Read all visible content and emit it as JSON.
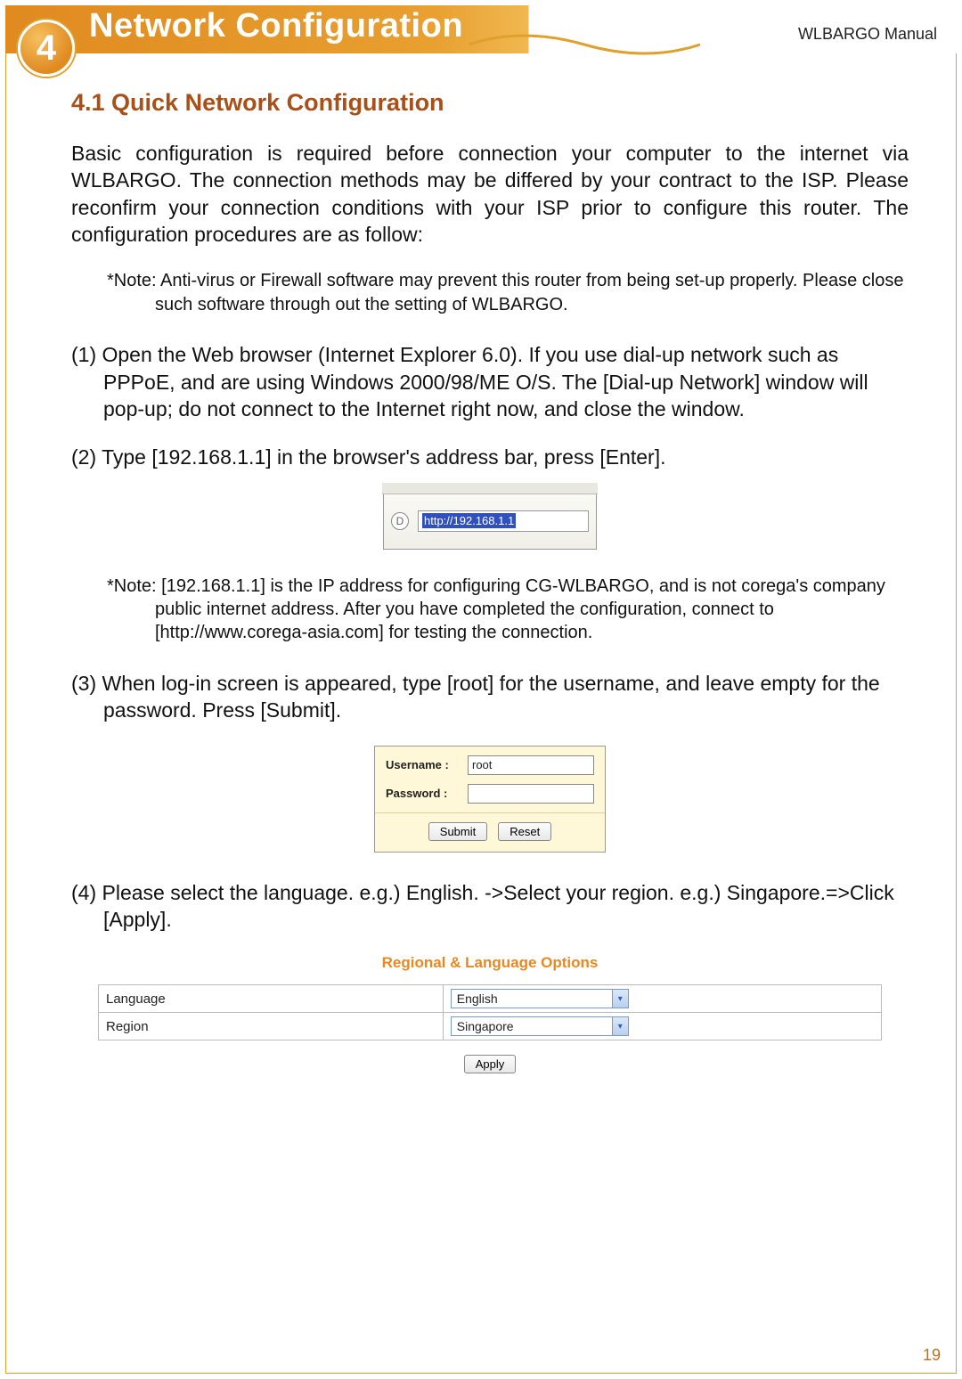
{
  "header": {
    "chapter_number": "4",
    "chapter_title": "Network Configuration",
    "manual_label": "WLBARGO Manual"
  },
  "section": {
    "title": "4.1 Quick Network Configuration",
    "intro": "Basic configuration is required before connection your computer to the internet via WLBARGO. The connection methods may be differed by your contract to the ISP. Please reconfirm your connection conditions with your ISP prior to configure this router. The configuration procedures are as follow:",
    "note1": "*Note: Anti-virus or Firewall software may prevent this router from being set-up properly. Please close such software through out the setting of WLBARGO.",
    "step1": "(1) Open the Web browser (Internet Explorer 6.0). If you use dial-up network such as PPPoE, and are using Windows 2000/98/ME O/S. The [Dial-up Network] window will pop-up; do not connect to the Internet right now, and close the window.",
    "step2": "(2) Type [192.168.1.1] in the browser's address bar, press [Enter].",
    "url_text": "http://192.168.1.1",
    "note2": "*Note: [192.168.1.1] is the IP address for configuring CG-WLBARGO, and is not corega's company public internet address. After you have completed the configuration, connect to [http://www.corega-asia.com] for testing the connection.",
    "step3": "(3) When log-in screen is appeared, type [root] for the username, and leave empty for the password. Press [Submit].",
    "login": {
      "username_label": "Username :",
      "username_value": "root",
      "password_label": "Password :",
      "password_value": "",
      "submit": "Submit",
      "reset": "Reset"
    },
    "step4": "(4) Please select the language. e.g.) English. ->Select your region. e.g.) Singapore.=>Click  [Apply].",
    "regional": {
      "title": "Regional & Language Options",
      "language_label": "Language",
      "language_value": "English",
      "region_label": "Region",
      "region_value": "Singapore",
      "apply": "Apply"
    }
  },
  "page_number": "19"
}
